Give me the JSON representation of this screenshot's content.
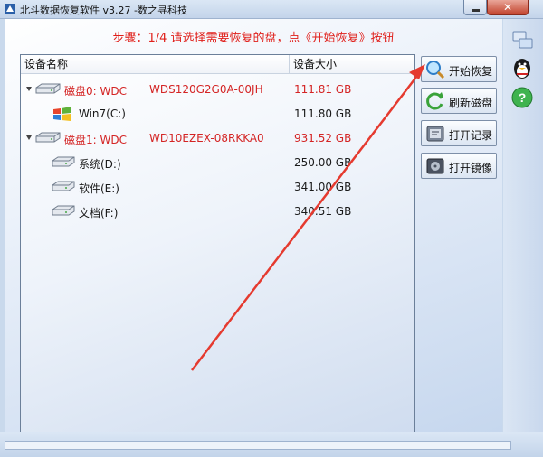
{
  "window": {
    "title": "北斗数据恢复软件 v3.27 -数之寻科技"
  },
  "step_text": "步骤：1/4 请选择需要恢复的盘，点《开始恢复》按钮",
  "table": {
    "headers": {
      "name": "设备名称",
      "size": "设备大小"
    },
    "rows": [
      {
        "kind": "disk",
        "label": "磁盘0: WDC",
        "model": "WDS120G2G0A-00JH",
        "size": "111.81 GB",
        "icon": "hard-disk-icon",
        "color": "#d42424"
      },
      {
        "kind": "partition",
        "label": "Win7(C:)",
        "size": "111.80 GB",
        "icon": "windows-logo-icon",
        "color": "#1a1a1a"
      },
      {
        "kind": "disk",
        "label": "磁盘1: WDC",
        "model": "WD10EZEX-08RKKA0",
        "size": "931.52 GB",
        "icon": "hard-disk-icon",
        "color": "#d42424"
      },
      {
        "kind": "partition",
        "label": "系统(D:)",
        "size": "250.00 GB",
        "icon": "drive-icon",
        "color": "#1a1a1a"
      },
      {
        "kind": "partition",
        "label": "软件(E:)",
        "size": "341.00 GB",
        "icon": "drive-icon",
        "color": "#1a1a1a"
      },
      {
        "kind": "partition",
        "label": "文档(F:)",
        "size": "340.51 GB",
        "icon": "drive-icon",
        "color": "#1a1a1a"
      }
    ]
  },
  "buttons": {
    "start_recovery": "开始恢复",
    "refresh_disks": "刷新磁盘",
    "open_record": "打开记录",
    "open_image": "打开镜像"
  },
  "side_icons": [
    "network-icon",
    "qq-penguin-icon",
    "help-icon"
  ],
  "colors": {
    "step_text": "#e0201b",
    "disk_text": "#d42424",
    "annotation_arrow": "#e53a2f"
  }
}
